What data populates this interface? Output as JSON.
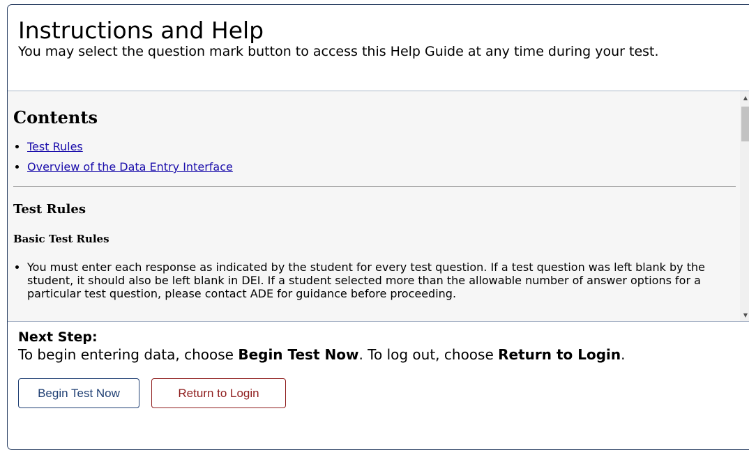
{
  "header": {
    "title": "Instructions and Help",
    "subtitle": "You may select the question mark button to access this Help Guide at any time during your test."
  },
  "content": {
    "contents_heading": "Contents",
    "toc": [
      "Test Rules",
      "Overview of the Data Entry Interface"
    ],
    "section_heading": "Test Rules",
    "sub_heading": "Basic Test Rules",
    "rules": [
      "You must enter each response as indicated by the student for every test question. If a test question was left blank by the student, it should also be left blank in DEI. If a student selected more than the allowable number of answer options for a particular test question, please contact ADE for guidance before proceeding."
    ]
  },
  "footer": {
    "next_label": "Next Step:",
    "text_1": "To begin entering data, choose ",
    "bold_1": "Begin Test Now",
    "text_2": ". To log out, choose ",
    "bold_2": "Return to Login",
    "text_3": ".",
    "begin_button": "Begin Test Now",
    "return_button": "Return to Login"
  },
  "colors": {
    "frame_border": "#2a3f63",
    "link": "#1a0dab",
    "begin_button": "#1f3f73",
    "return_button": "#8e1c1c",
    "content_bg": "#f6f6f6"
  },
  "icons": {
    "scroll_up": "scroll-up-arrow-icon",
    "scroll_down": "scroll-down-arrow-icon"
  }
}
